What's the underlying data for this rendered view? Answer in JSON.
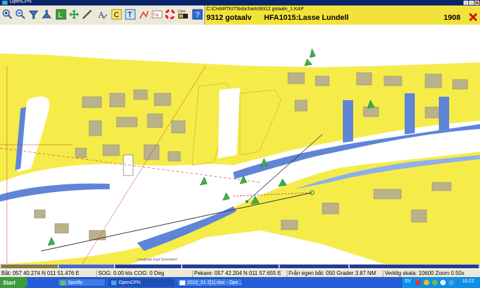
{
  "window": {
    "title": "OpenCPN"
  },
  "chart_info": {
    "path": "C:\\CHARTKIT\\bsbcharts\\9312 gotaalv_1.KAP",
    "chart_name": "9312 gotaalv",
    "publication": "HFA1015:Lasse Lundell",
    "edition": "1908"
  },
  "map": {
    "grid_label": "Longitude East Greenwich"
  },
  "status_bar": {
    "boat_position": "Båt: 057 40.274 N   011 51.476 E",
    "sog_cog": "SOG: 0.00 kts  COG:  0 Deg",
    "cursor": "Pekare: 057 42.204 N 011 57.655 E",
    "from_boat": "Från egen båt: 050 Grader   3.87 NM",
    "scale": "Verklig skala:    10600  Zoom 0.50x"
  },
  "taskbar": {
    "start": "Start",
    "items": [
      "Spotify",
      "OpenCPN",
      "2010_01 2[1].xlsx - Ope..."
    ],
    "language": "SV",
    "clock": "10:22"
  },
  "colors": {
    "land": "#f5ec4a",
    "water": "#ffffff",
    "shallow": "#5f85d8",
    "chart_header": "#f2e33c"
  }
}
